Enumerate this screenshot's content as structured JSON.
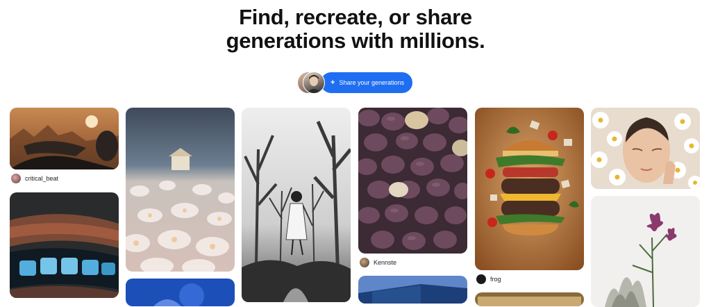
{
  "hero": {
    "line1": "Find, recreate, or share",
    "line2": "generations with millions."
  },
  "cta": {
    "plus": "+",
    "label": "Share your generations"
  },
  "feed": {
    "users": {
      "critical_beat": "critical_beat",
      "kennste": "Kennste",
      "frog": "frog"
    },
    "images": [
      "desert-hover-bike",
      "neon-grill-teeth",
      "flower-field-gazebo",
      "blue-night-scene",
      "bw-girl-in-forest",
      "purple-stones",
      "building-roof",
      "floating-burger",
      "food-tray",
      "woman-with-daisies",
      "dried-flower-vase"
    ]
  },
  "colors": {
    "accent": "#1f6ef2",
    "title": "#111111"
  }
}
